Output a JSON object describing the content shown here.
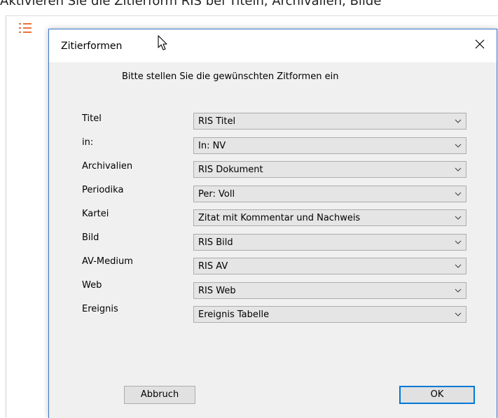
{
  "background": {
    "caption_text": "Aktivieren Sie die Zitierform RIS bei Titeln, Archivalien, Bilde"
  },
  "dialog": {
    "title": "Zitierformen",
    "instruction": "Bitte stellen Sie die gewünschten Zitformen ein",
    "rows": [
      {
        "label": "Titel",
        "value": "RIS Titel"
      },
      {
        "label": "in:",
        "value": "In: NV"
      },
      {
        "label": "Archivalien",
        "value": "RIS Dokument"
      },
      {
        "label": "Periodika",
        "value": "Per: Voll"
      },
      {
        "label": "Kartei",
        "value": "Zitat mit Kommentar und Nachweis"
      },
      {
        "label": "Bild",
        "value": "RIS Bild"
      },
      {
        "label": "AV-Medium",
        "value": "RIS AV"
      },
      {
        "label": "Web",
        "value": "RIS Web"
      },
      {
        "label": "Ereignis",
        "value": "Ereignis Tabelle"
      }
    ],
    "cancel_label": "Abbruch",
    "ok_label": "OK"
  },
  "icons": {
    "list": "list-icon",
    "close": "close-icon",
    "cursor": "mouse-pointer-icon",
    "chevron": "chevron-down-icon"
  },
  "colors": {
    "accent": "#0078d7",
    "list_icon": "#e8743b",
    "dialog_bg": "#f0f0f0",
    "select_bg": "#e5e5e5"
  }
}
